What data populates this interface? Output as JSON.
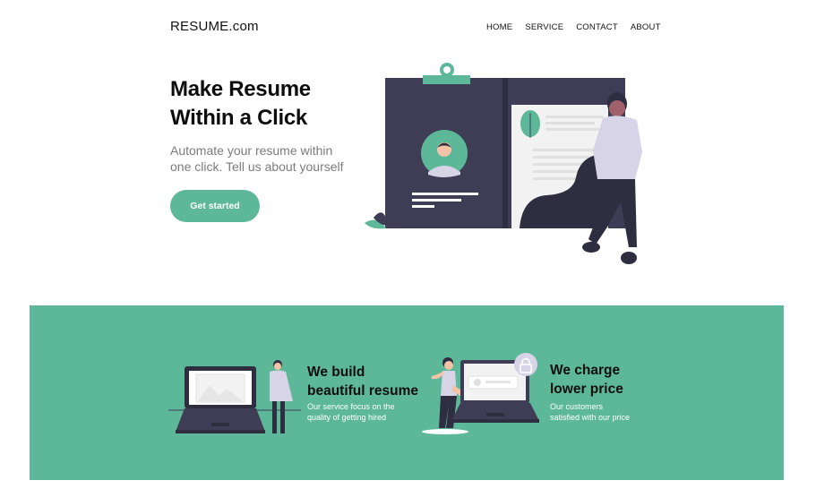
{
  "header": {
    "brand": "RESUME.com",
    "nav": [
      "HOME",
      "SERVICE",
      "CONTACT",
      "ABOUT"
    ]
  },
  "hero": {
    "title_line1": "Make Resume",
    "title_line2": "Within a Click",
    "subtitle_line1": "Automate your resume within",
    "subtitle_line2": "one click. Tell us about yourself",
    "cta": "Get started"
  },
  "features": [
    {
      "title_line1": "We build",
      "title_line2": "beautiful resume",
      "desc_line1": "Our service focus on the",
      "desc_line2": "quality of getting hired"
    },
    {
      "title_line1": "We charge",
      "title_line2": "lower price",
      "desc_line1": "Our customers",
      "desc_line2": "satisfied with our price"
    }
  ],
  "colors": {
    "accent": "#5cb899",
    "dark": "#3f3d56",
    "light_purple": "#d6d4e6"
  },
  "icons": [
    "resume-illustration-icon",
    "laptop-image-icon",
    "laptop-lock-icon"
  ]
}
